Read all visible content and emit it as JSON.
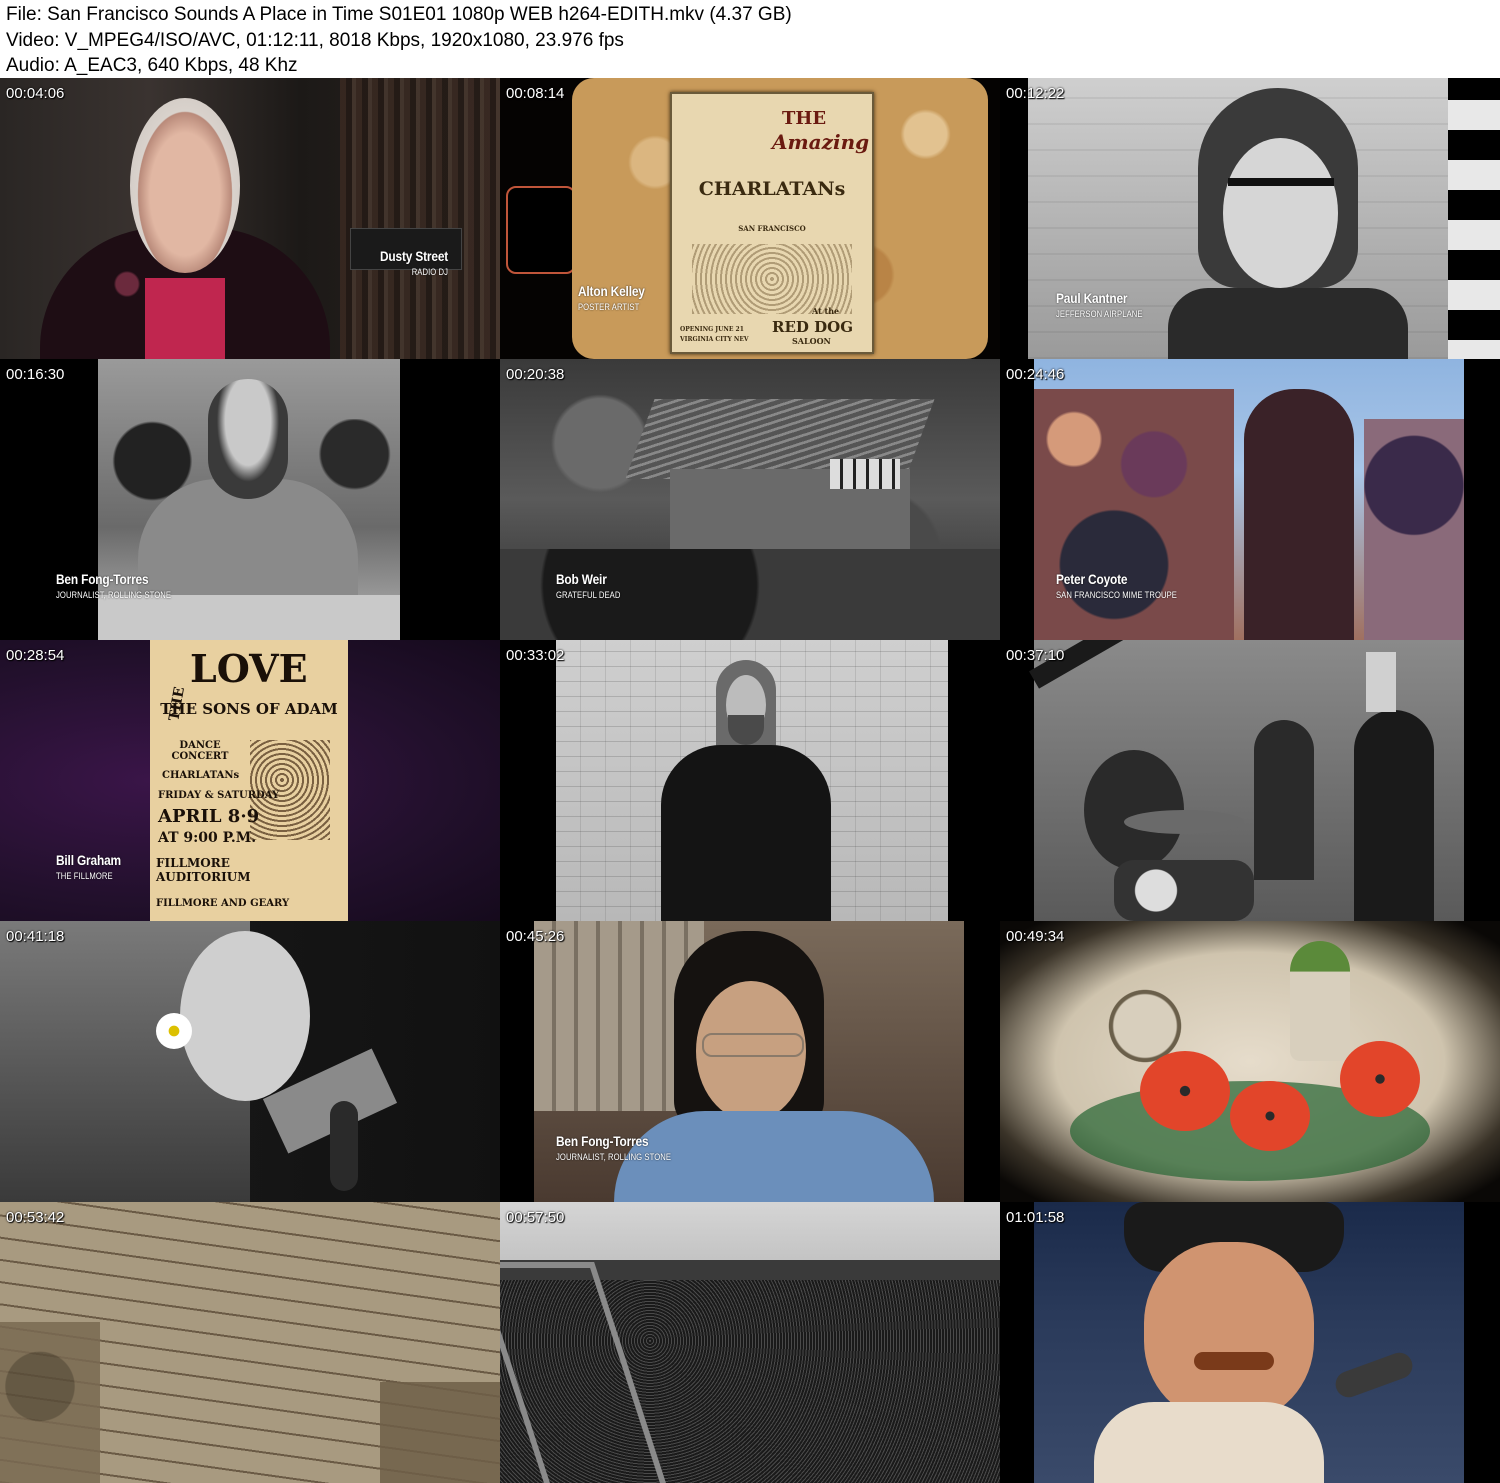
{
  "header": {
    "file_line": "File: San Francisco Sounds A Place in Time S01E01 1080p WEB h264-EDITH.mkv (4.37 GB)",
    "video_line": "Video: V_MPEG4/ISO/AVC, 01:12:11, 8018 Kbps, 1920x1080, 23.976 fps",
    "audio_line": "Audio: A_EAC3, 640 Kbps, 48 Khz"
  },
  "thumbnails": [
    {
      "timestamp": "00:04:06",
      "name": "Dusty Street",
      "role": "RADIO DJ"
    },
    {
      "timestamp": "00:08:14",
      "name": "Alton Kelley",
      "role": "POSTER ARTIST",
      "poster": {
        "the": "THE",
        "amazing": "Amazing",
        "band": "CHARLATANs",
        "city": "SAN FRANCISCO",
        "venue": "RED DOG",
        "venue2": "SALOON",
        "date": "OPENING JUNE 21",
        "place": "VIRGINIA CITY NEV",
        "at": "At the"
      }
    },
    {
      "timestamp": "00:12:22",
      "name": "Paul Kantner",
      "role": "JEFFERSON AIRPLANE"
    },
    {
      "timestamp": "00:16:30",
      "name": "Ben Fong-Torres",
      "role": "JOURNALIST, ROLLING STONE"
    },
    {
      "timestamp": "00:20:38",
      "name": "Bob Weir",
      "role": "GRATEFUL DEAD"
    },
    {
      "timestamp": "00:24:46",
      "name": "Peter Coyote",
      "role": "SAN FRANCISCO MIME TROUPE"
    },
    {
      "timestamp": "00:28:54",
      "name": "Bill Graham",
      "role": "THE FILLMORE",
      "poster": {
        "the": "THE",
        "love": "LOVE",
        "sons": "THE SONS OF ADAM",
        "dance": "DANCE CONCERT",
        "band": "CHARLATANs",
        "days": "FRIDAY & SATURDAY",
        "date": "APRIL 8·9",
        "time": "AT 9:00 P.M.",
        "hall": "FILLMORE AUDITORIUM",
        "address": "FILLMORE AND GEARY"
      }
    },
    {
      "timestamp": "00:33:02"
    },
    {
      "timestamp": "00:37:10"
    },
    {
      "timestamp": "00:41:18"
    },
    {
      "timestamp": "00:45:26",
      "name": "Ben Fong-Torres",
      "role": "JOURNALIST, ROLLING STONE"
    },
    {
      "timestamp": "00:49:34"
    },
    {
      "timestamp": "00:53:42"
    },
    {
      "timestamp": "00:57:50"
    },
    {
      "timestamp": "01:01:58"
    }
  ],
  "colors": {
    "page_bg": "#ffffff",
    "grid_bg": "#000000",
    "timestamp_text": "#ffffff",
    "purple_bg": "#2a0f35",
    "poster_paper": "#e8d7b0",
    "plywood": "#c89a5a",
    "poppy_red": "#e2452a"
  }
}
